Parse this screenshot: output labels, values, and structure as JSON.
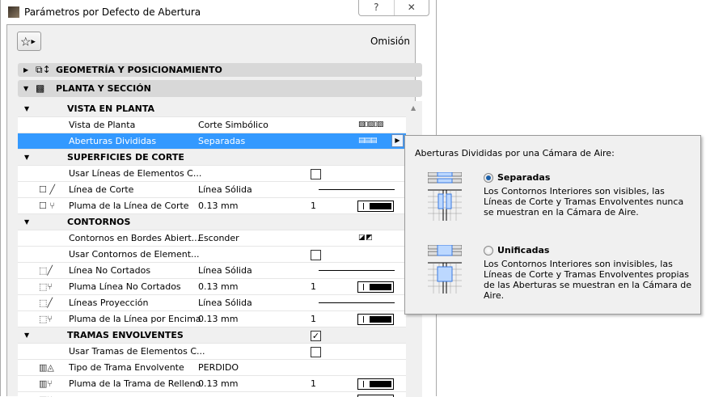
{
  "window": {
    "title": "Parámetros por Defecto de Abertura",
    "help": "?",
    "close": "✕"
  },
  "toolbar": {
    "favorites_icon": "☆",
    "favorites_arrow": "▶",
    "omision": "Omisión"
  },
  "sections": [
    {
      "label": "GEOMETRÍA Y POSICIONAMIENTO",
      "expanded": false,
      "tri": "▶",
      "icon": "⧉↕"
    },
    {
      "label": "PLANTA Y SECCIÓN",
      "expanded": true,
      "tri": "▼",
      "icon": "▩"
    }
  ],
  "rows": [
    {
      "type": "group",
      "label": "VISTA EN PLANTA"
    },
    {
      "label": "Vista de Planta",
      "value": "Corte Simbólico",
      "pattern": "▨▯▨▯▨"
    },
    {
      "label": "Aberturas Divididas",
      "value": "Separadas",
      "pattern": "▤▤▤",
      "selected": true
    },
    {
      "type": "group",
      "label": "SUPERFICIES DE CORTE"
    },
    {
      "label": "Usar Líneas de Elementos C...",
      "checkbox": false
    },
    {
      "icon": "☐ ╱",
      "label": "Línea de Corte",
      "value": "Línea Sólida",
      "line": true
    },
    {
      "icon": "☐ ⑂",
      "label": "Pluma de la Línea de Corte",
      "value": "0.13 mm",
      "c3": "1",
      "pen": true
    },
    {
      "type": "group",
      "label": "CONTORNOS"
    },
    {
      "label": "Contornos en Bordes Abiert...",
      "value": "Esconder",
      "pattern": "◪  ◩"
    },
    {
      "label": "Usar Contornos de Element...",
      "checkbox": false
    },
    {
      "icon": "⬚╱",
      "label": "Línea No Cortados",
      "value": "Línea Sólida",
      "line": true
    },
    {
      "icon": "⬚⑂",
      "label": "Pluma Línea No Cortados",
      "value": "0.13 mm",
      "c3": "1",
      "pen": true
    },
    {
      "icon": "⬚╱",
      "label": "Líneas Proyección",
      "value": "Línea Sólida",
      "line": true
    },
    {
      "icon": "⬚⑂",
      "label": "Pluma de la Línea por Encima",
      "value": "0.13 mm",
      "c3": "1",
      "pen": true
    },
    {
      "type": "group",
      "label": "TRAMAS ENVOLVENTES",
      "checkbox": true
    },
    {
      "label": "Usar Tramas de Elementos C...",
      "checkbox": false
    },
    {
      "icon": "▥◬",
      "label": "Tipo de Trama Envolvente",
      "value": "PERDIDO"
    },
    {
      "icon": "▥⑂",
      "label": "Pluma de la Trama de Relleno",
      "value": "0.13 mm",
      "c3": "1",
      "pen": true
    },
    {
      "icon": "▥⑂",
      "label": "",
      "value": "",
      "pen": true
    }
  ],
  "popup": {
    "heading": "Aberturas Divididas por una Cámara de Aire:",
    "options": [
      {
        "name": "Separadas",
        "selected": true,
        "desc": "Los Contornos Interiores son visibles, las Líneas de Corte y Tramas Envolventes nunca se muestran en la Cámara de Aire."
      },
      {
        "name": "Unificadas",
        "selected": false,
        "desc": "Los Contornos Interiores son invisibles, las Líneas de Corte y Tramas Envolventes propias de las Aberturas se muestran en la Cámara de Aire."
      }
    ]
  },
  "colors": {
    "selection": "#3399ff",
    "accent": "#1a5fa8"
  }
}
